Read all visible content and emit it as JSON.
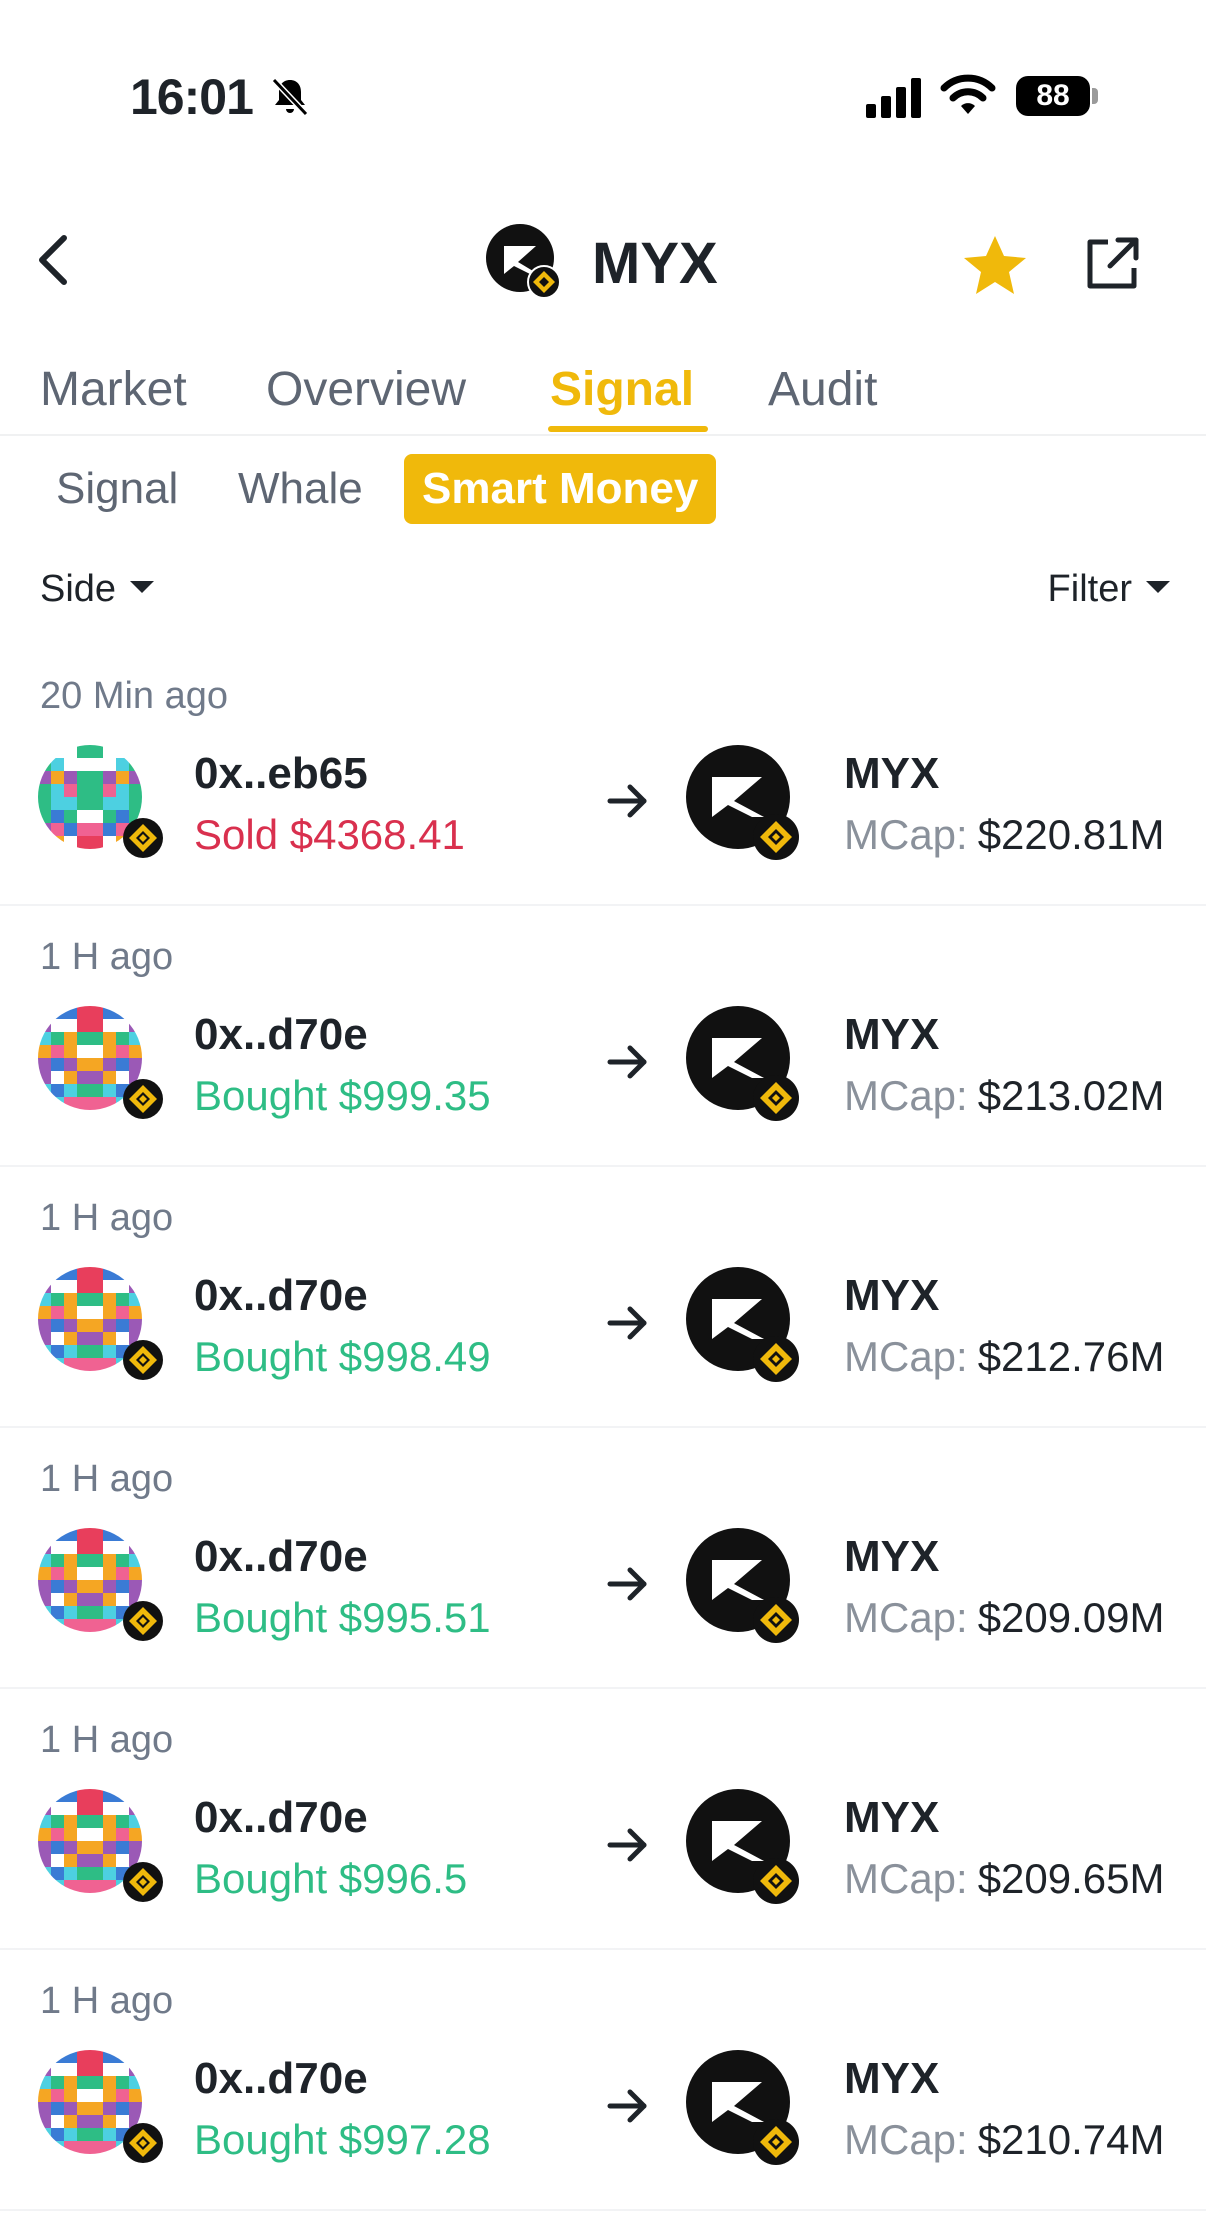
{
  "status_bar": {
    "time": "16:01",
    "battery": "88"
  },
  "header": {
    "title": "MYX"
  },
  "tabs": [
    {
      "label": "Market"
    },
    {
      "label": "Overview"
    },
    {
      "label": "Signal",
      "active": true
    },
    {
      "label": "Audit"
    }
  ],
  "sub_tabs": [
    {
      "label": "Signal"
    },
    {
      "label": "Whale"
    },
    {
      "label": "Smart Money",
      "active": true
    }
  ],
  "filters": {
    "side": "Side",
    "filter": "Filter"
  },
  "trades": [
    {
      "time": "20 Min ago",
      "address": "0x..eb65",
      "action": "Sold",
      "amount": "$4368.41",
      "token": "MYX",
      "mcap_label": "MCap:",
      "mcap": "$220.81M"
    },
    {
      "time": "1 H ago",
      "address": "0x..d70e",
      "action": "Bought",
      "amount": "$999.35",
      "token": "MYX",
      "mcap_label": "MCap:",
      "mcap": "$213.02M"
    },
    {
      "time": "1 H ago",
      "address": "0x..d70e",
      "action": "Bought",
      "amount": "$998.49",
      "token": "MYX",
      "mcap_label": "MCap:",
      "mcap": "$212.76M"
    },
    {
      "time": "1 H ago",
      "address": "0x..d70e",
      "action": "Bought",
      "amount": "$995.51",
      "token": "MYX",
      "mcap_label": "MCap:",
      "mcap": "$209.09M"
    },
    {
      "time": "1 H ago",
      "address": "0x..d70e",
      "action": "Bought",
      "amount": "$996.5",
      "token": "MYX",
      "mcap_label": "MCap:",
      "mcap": "$209.65M"
    },
    {
      "time": "1 H ago",
      "address": "0x..d70e",
      "action": "Bought",
      "amount": "$997.28",
      "token": "MYX",
      "mcap_label": "MCap:",
      "mcap": "$210.74M"
    }
  ],
  "colors": {
    "accent": "#f0b90b",
    "sold": "#d9304e",
    "bought": "#2ebd85",
    "muted": "#707a8a"
  },
  "icons": {
    "back": "chevron-left-icon",
    "favorite": "star-icon",
    "share": "share-icon",
    "arrow": "arrow-right-icon",
    "chain": "bnb-chain-icon"
  }
}
